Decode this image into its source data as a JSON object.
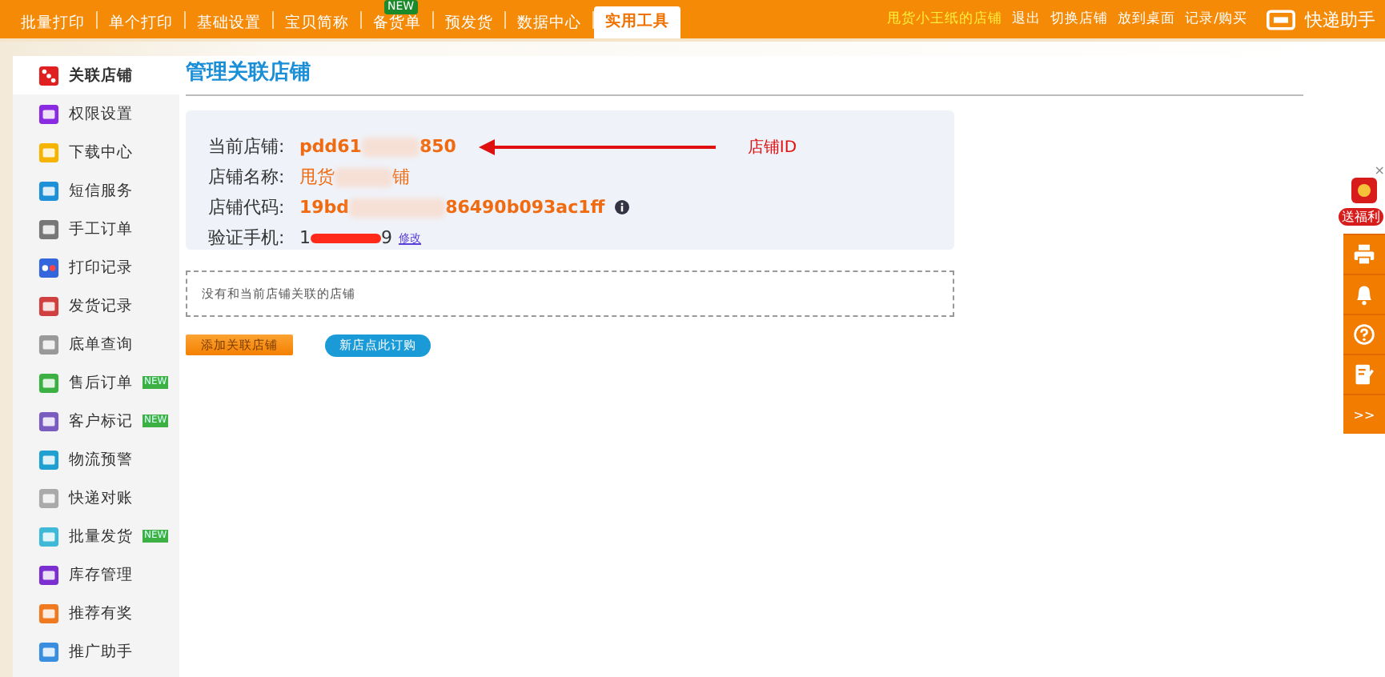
{
  "top_nav": {
    "items": [
      {
        "label": "批量打印",
        "selected": false
      },
      {
        "label": "单个打印",
        "selected": false
      },
      {
        "label": "基础设置",
        "selected": false
      },
      {
        "label": "宝贝简称",
        "selected": false
      },
      {
        "label": "备货单",
        "selected": false,
        "badge": "NEW"
      },
      {
        "label": "预发货",
        "selected": false
      },
      {
        "label": "数据中心",
        "selected": false
      },
      {
        "label": "实用工具",
        "selected": true
      }
    ],
    "shop_name": "甩货小王纸的店铺",
    "links": [
      "退出",
      "切换店铺",
      "放到桌面",
      "记录/购买"
    ],
    "brand": "快递助手"
  },
  "sidebar": {
    "items": [
      {
        "label": "关联店铺",
        "selected": true
      },
      {
        "label": "权限设置",
        "selected": false
      },
      {
        "label": "下载中心",
        "selected": false
      },
      {
        "label": "短信服务",
        "selected": false
      },
      {
        "label": "手工订单",
        "selected": false
      },
      {
        "label": "打印记录",
        "selected": false
      },
      {
        "label": "发货记录",
        "selected": false
      },
      {
        "label": "底单查询",
        "selected": false
      },
      {
        "label": "售后订单",
        "selected": false,
        "badge": "NEW"
      },
      {
        "label": "客户标记",
        "selected": false,
        "badge": "NEW"
      },
      {
        "label": "物流预警",
        "selected": false
      },
      {
        "label": "快递对账",
        "selected": false
      },
      {
        "label": "批量发货",
        "selected": false,
        "badge": "NEW"
      },
      {
        "label": "库存管理",
        "selected": false
      },
      {
        "label": "推荐有奖",
        "selected": false
      },
      {
        "label": "推广助手",
        "selected": false
      }
    ]
  },
  "page": {
    "title": "管理关联店铺",
    "info": [
      {
        "label": "当前店铺:",
        "value_start": "pdd61",
        "value_end": "850",
        "kind": "bold"
      },
      {
        "label": "店铺名称:",
        "value_start": "甩货",
        "value_end": "铺",
        "kind": "plain"
      },
      {
        "label": "店铺代码:",
        "value_start": "19bd",
        "value_end": "86490b093ac1ff",
        "kind": "code"
      },
      {
        "label": "验证手机:",
        "value_start": "1",
        "value_end": "9",
        "kind": "phone",
        "link": "修改"
      }
    ],
    "annotation": "店铺ID",
    "empty_message": "没有和当前店铺关联的店铺",
    "buttons": [
      {
        "label": "添加关联店铺",
        "kind": "orange"
      },
      {
        "label": "新店点此订购",
        "kind": "blue"
      }
    ]
  },
  "side_float": {
    "promo": "送福利",
    "close": "×",
    "more": ">>"
  }
}
